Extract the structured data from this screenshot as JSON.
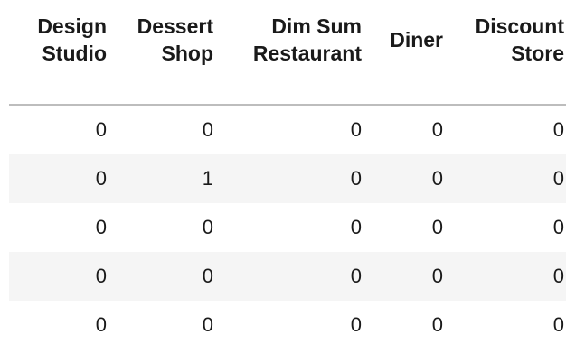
{
  "table": {
    "columns": [
      "Design Studio",
      "Dessert Shop",
      "Dim Sum Restaurant",
      "Diner",
      "Discount Store"
    ],
    "header_lines": [
      [
        "Design",
        "Studio"
      ],
      [
        "Dessert",
        "Shop"
      ],
      [
        "Dim Sum",
        "Restaurant"
      ],
      [
        "Diner"
      ],
      [
        "Discount",
        "Store"
      ]
    ],
    "rows": [
      [
        "0",
        "0",
        "0",
        "0",
        "0"
      ],
      [
        "0",
        "1",
        "0",
        "0",
        "0"
      ],
      [
        "0",
        "0",
        "0",
        "0",
        "0"
      ],
      [
        "0",
        "0",
        "0",
        "0",
        "0"
      ],
      [
        "0",
        "0",
        "0",
        "0",
        "0"
      ]
    ]
  }
}
